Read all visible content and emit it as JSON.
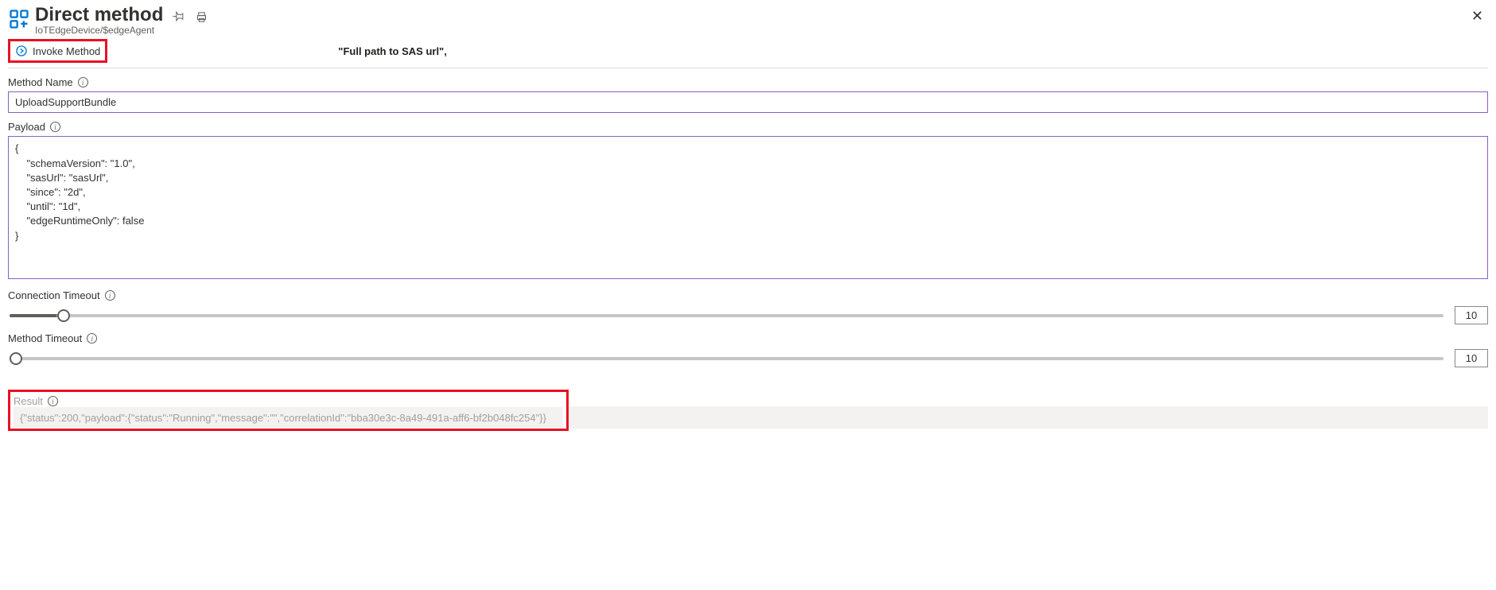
{
  "header": {
    "title": "Direct method",
    "subtitle": "IoTEdgeDevice/$edgeAgent"
  },
  "toolbar": {
    "invoke_label": "Invoke Method",
    "sas_text": "\"Full path to SAS url\","
  },
  "fields": {
    "method_name_label": "Method Name",
    "method_name_value": "UploadSupportBundle",
    "payload_label": "Payload",
    "payload_value": "{\n    \"schemaVersion\": \"1.0\",\n    \"sasUrl\": \"sasUrl\",\n    \"since\": \"2d\",\n    \"until\": \"1d\",\n    \"edgeRuntimeOnly\": false\n}",
    "connection_timeout_label": "Connection Timeout",
    "connection_timeout_value": "10",
    "method_timeout_label": "Method Timeout",
    "method_timeout_value": "10",
    "result_label": "Result",
    "result_value": "{\"status\":200,\"payload\":{\"status\":\"Running\",\"message\":\"\",\"correlationId\":\"bba30e3c-8a49-491a-aff6-bf2b048fc254\"}}"
  }
}
